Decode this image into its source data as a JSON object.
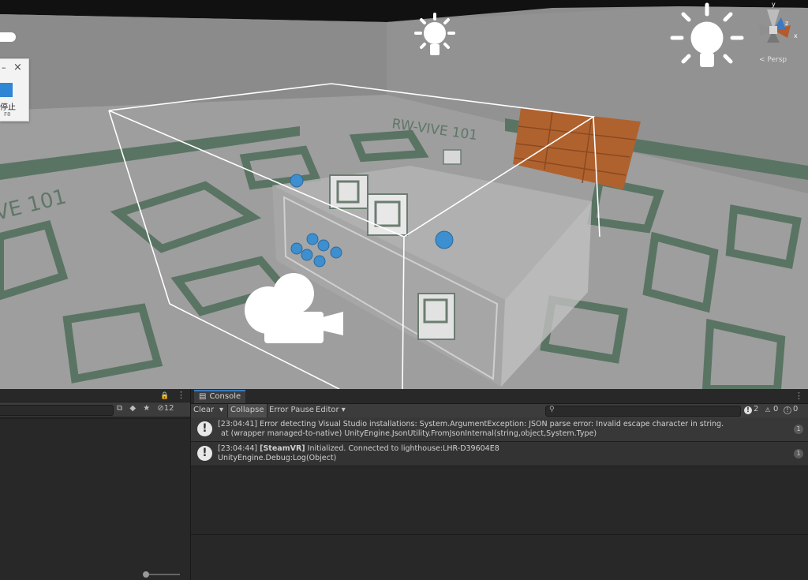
{
  "window_overlay": {
    "label": "停止",
    "shortcut": "F8",
    "min_glyph": "–",
    "close_glyph": "×"
  },
  "scene": {
    "floor_text_1": "RW-VIVE 101",
    "floor_text_2": "VE 101",
    "gizmo_axis_y": "y",
    "gizmo_axis_z": "z",
    "gizmo_axis_x": "x",
    "persp_label": "< Persp",
    "colors": {
      "floor": "#9c9c9c",
      "wall": "#8a8a8a",
      "stripe": "#577060",
      "ball": "#3d8fcf",
      "brick": "#b0622e",
      "bbox": "#ffffff"
    }
  },
  "left_panel": {
    "lock_icon": "🔒",
    "menu_icon": "⋮",
    "hidden_count": "12"
  },
  "console": {
    "tab_label": "Console",
    "toolbar": {
      "clear": "Clear",
      "collapse": "Collapse",
      "error_pause": "Error Pause",
      "editor": "Editor",
      "error_count": "2",
      "warning_count": "0",
      "info_count": "0"
    },
    "entries": [
      {
        "line1": "[23:04:41] Error detecting Visual Studio installations: System.ArgumentException: JSON parse error: Invalid escape character in string.",
        "line2": "at (wrapper managed-to-native) UnityEngine.JsonUtility.FromJsonInternal(string,object,System.Type)",
        "count": "1"
      },
      {
        "time": "[23:04:44]",
        "tag": "[SteamVR]",
        "msg": " Initialized. Connected to lighthouse:LHR-D39604E8",
        "line2": "UnityEngine.Debug:Log(Object)",
        "count": "1"
      }
    ]
  }
}
